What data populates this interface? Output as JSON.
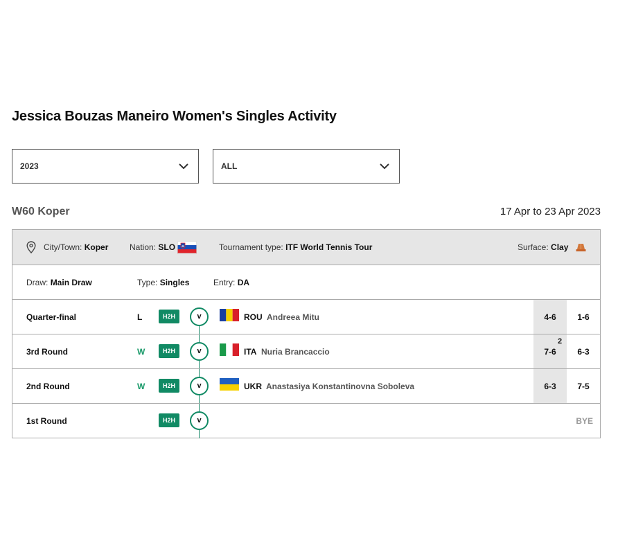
{
  "page": {
    "title": "Jessica Bouzas Maneiro Women's Singles Activity"
  },
  "filters": {
    "year": "2023",
    "type": "ALL"
  },
  "tournament": {
    "name": "W60 Koper",
    "dates": "17 Apr to 23 Apr 2023",
    "city_label": "City/Town:",
    "city": "Koper",
    "nation_label": "Nation:",
    "nation": "SLO",
    "type_label": "Tournament type:",
    "type": "ITF World Tennis Tour",
    "surface_label": "Surface:",
    "surface": "Clay",
    "draw_label": "Draw:",
    "draw": "Main Draw",
    "event_type_label": "Type:",
    "event_type": "Singles",
    "entry_label": "Entry:",
    "entry": "DA"
  },
  "colors": {
    "accent": "#118a64",
    "win": "#1a9a6a",
    "clay": "#c8642a"
  },
  "matches": [
    {
      "round": "Quarter-final",
      "result": "L",
      "h2h": "H2H",
      "vs": "v",
      "nation": "ROU",
      "opponent": "Andreea Mitu",
      "set1": "4-6",
      "set2": "1-6",
      "tiebreak": ""
    },
    {
      "round": "3rd Round",
      "result": "W",
      "h2h": "H2H",
      "vs": "v",
      "nation": "ITA",
      "opponent": "Nuria Brancaccio",
      "set1": "7-6",
      "set2": "6-3",
      "tiebreak": "2"
    },
    {
      "round": "2nd Round",
      "result": "W",
      "h2h": "H2H",
      "vs": "v",
      "nation": "UKR",
      "opponent": "Anastasiya Konstantinovna Soboleva",
      "set1": "6-3",
      "set2": "7-5",
      "tiebreak": ""
    },
    {
      "round": "1st Round",
      "result": "",
      "h2h": "H2H",
      "vs": "v",
      "bye": "BYE"
    }
  ]
}
